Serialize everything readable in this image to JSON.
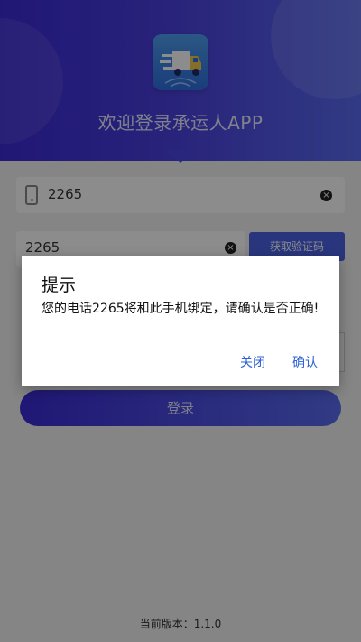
{
  "header": {
    "title": "欢迎登录承运人APP"
  },
  "form": {
    "phone_value": "2265",
    "code_value": "2265",
    "get_code_label": "获取验证码",
    "login_label": "登录"
  },
  "footer": {
    "version_text": "当前版本：1.1.0"
  },
  "dialog": {
    "title": "提示",
    "message": "您的电话2265将和此手机绑定，请确认是否正确!",
    "close_label": "关闭",
    "confirm_label": "确认"
  },
  "icons": {
    "clear": "clear-circle-icon",
    "phone": "phone-icon",
    "logo": "truck-logo"
  },
  "colors": {
    "brand": "#3b2bd6",
    "accent": "#4b63e6",
    "dialog_button": "#2f62d6"
  }
}
